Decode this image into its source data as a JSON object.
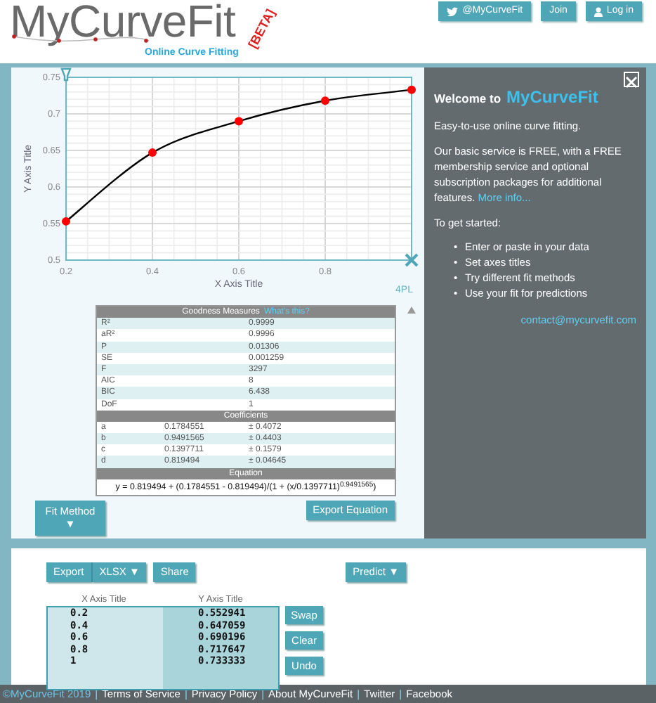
{
  "header": {
    "logo": "MyCurveFit",
    "tagline": "Online Curve Fitting",
    "badge": "[BETA]",
    "buttons": [
      {
        "label": "@MyCurveFit",
        "kind": "social"
      },
      {
        "label": "Join",
        "kind": "plain"
      },
      {
        "label": "Log in",
        "kind": "account"
      }
    ]
  },
  "chart": {
    "model": "4PL",
    "chart_data": {
      "type": "line",
      "xlabel": "X Axis Title",
      "ylabel": "Y Axis Title",
      "x": [
        0.2,
        0.4,
        0.6,
        0.8,
        1
      ],
      "series": [
        {
          "color": "#ff0000",
          "marker": true,
          "values": [
            0.553,
            0.647,
            0.69,
            0.718,
            0.733
          ]
        }
      ],
      "grid": true,
      "xlim": [
        0.2,
        1
      ],
      "ylim": [
        0.5,
        0.75
      ],
      "xticks": [
        0.2,
        0.4,
        0.6,
        0.8
      ],
      "yticks": [
        0.5,
        0.55,
        0.6,
        0.65,
        0.7,
        0.75
      ]
    }
  },
  "goodness": {
    "title": "Goodness Measures",
    "help_link": "What's this?",
    "rows": [
      {
        "name": "R²",
        "value": "0.9999"
      },
      {
        "name": "aR²",
        "value": "0.9996"
      },
      {
        "name": "P",
        "value": "0.01306"
      },
      {
        "name": "SE",
        "value": "0.001259"
      },
      {
        "name": "F",
        "value": "3297"
      },
      {
        "name": "AIC",
        "value": "8"
      },
      {
        "name": "BIC",
        "value": "6.438"
      },
      {
        "name": "DoF",
        "value": "1"
      }
    ]
  },
  "coefficients": {
    "title": "Coefficients",
    "rows": [
      {
        "name": "a",
        "value": "0.1784551",
        "error": "± 0.4072"
      },
      {
        "name": "b",
        "value": "0.9491565",
        "error": "± 0.4403"
      },
      {
        "name": "c",
        "value": "0.1397711",
        "error": "± 0.1579"
      },
      {
        "name": "d",
        "value": "0.819494",
        "error": "± 0.04645"
      }
    ]
  },
  "equation": {
    "title": "Equation",
    "text": "y = 0.819494 + (0.1784551 - 0.819494)/(1 + (x/0.1397711)$^{0.9491565}$)"
  },
  "fit_method_button": {
    "label": "Fit Method",
    "caret": "▼"
  },
  "export_equation_button": "Export Equation",
  "welcome": {
    "title": "Welcome to",
    "brand": "MyCurveFit",
    "intro": "Easy-to-use online curve fitting.",
    "service": "Our basic service is FREE, with a FREE membership service and optional subscription packages for additional features.",
    "more_link": "More info...",
    "start": "To get started:",
    "steps": [
      {
        "bullet": "•",
        "text": "Enter or paste in your data"
      },
      {
        "bullet": "•",
        "text": "Set axes titles"
      },
      {
        "bullet": "•",
        "text": "Try different fit methods"
      },
      {
        "bullet": "•",
        "text": "Use your fit for predictions"
      }
    ],
    "contact": "contact@mycurvefit.com"
  },
  "data_panel": {
    "export_button": "Export",
    "format_button": "XLSX ▼",
    "share_button": "Share",
    "predict_button": "Predict ▼",
    "columns": [
      "X Axis Title",
      "Y Axis Title"
    ],
    "rows": [
      [
        "0.2",
        "0.552941"
      ],
      [
        "0.4",
        "0.647059"
      ],
      [
        "0.6",
        "0.690196"
      ],
      [
        "0.8",
        "0.717647"
      ],
      [
        "1",
        "0.733333"
      ]
    ],
    "actions": [
      "Swap",
      "Clear",
      "Undo"
    ]
  },
  "footer": [
    {
      "text": "©MyCurveFit 2019",
      "kind": "brand"
    },
    {
      "text": "|",
      "kind": "separator"
    },
    {
      "text": "Terms of Service",
      "kind": "link"
    },
    {
      "text": "|",
      "kind": "separator"
    },
    {
      "text": "Privacy Policy",
      "kind": "link"
    },
    {
      "text": "|",
      "kind": "separator"
    },
    {
      "text": "About MyCurveFit",
      "kind": "link"
    },
    {
      "text": "|",
      "kind": "separator"
    },
    {
      "text": "Twitter",
      "kind": "link"
    },
    {
      "text": "|",
      "kind": "separator"
    },
    {
      "text": "Facebook",
      "kind": "link"
    }
  ]
}
